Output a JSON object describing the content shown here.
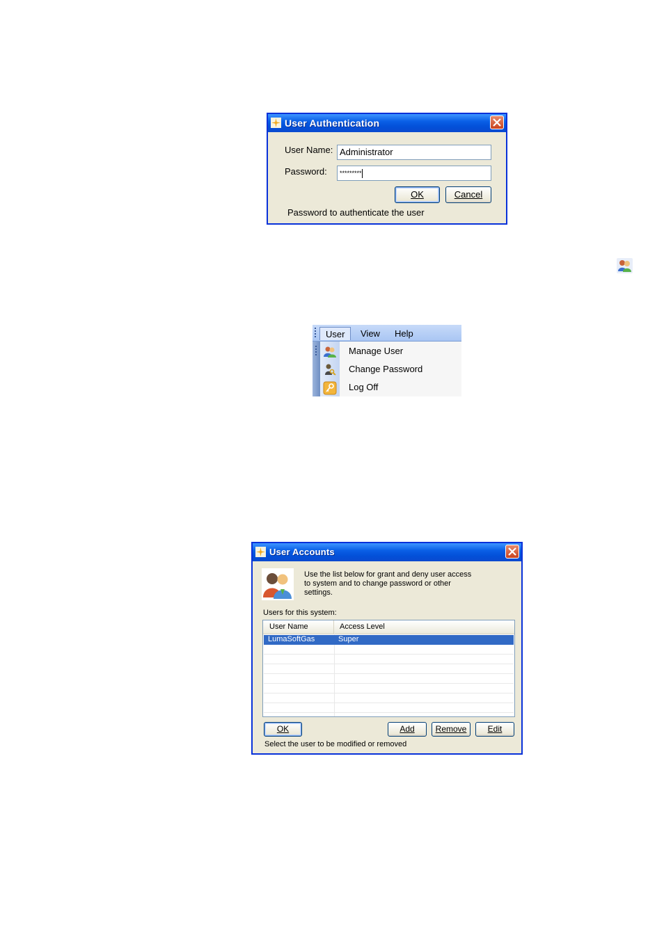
{
  "auth_dialog": {
    "title": "User Authentication",
    "username_label": "User Name:",
    "username_value": "Administrator",
    "password_label": "Password:",
    "password_value": "*********",
    "ok_label": "OK",
    "cancel_label": "Cancel",
    "status": "Password to authenticate the user"
  },
  "toolbar_icon": "manage-users-icon",
  "menu": {
    "tabs": [
      {
        "label": "User"
      },
      {
        "label": "View"
      },
      {
        "label": "Help"
      }
    ],
    "items": [
      {
        "label": "Manage User",
        "icon": "users-icon"
      },
      {
        "label": "Change Password",
        "icon": "key-user-icon"
      },
      {
        "label": "Log Off",
        "icon": "key-icon"
      }
    ]
  },
  "accounts_dialog": {
    "title": "User Accounts",
    "description": "Use the list below for grant and deny user access to system and to change password or other settings.",
    "list_caption": "Users for this system:",
    "columns": [
      "User Name",
      "Access Level"
    ],
    "rows": [
      {
        "user": "LumaSoftGas",
        "level": "Super"
      }
    ],
    "ok_label": "OK",
    "add_label": "Add",
    "remove_label": "Remove",
    "edit_label": "Edit",
    "status": "Select the user to be modified or removed"
  },
  "colors": {
    "title_bar": "#0a5fe6",
    "window_border": "#0831d9",
    "dialog_face": "#ece9d8",
    "selection": "#316ac5"
  }
}
